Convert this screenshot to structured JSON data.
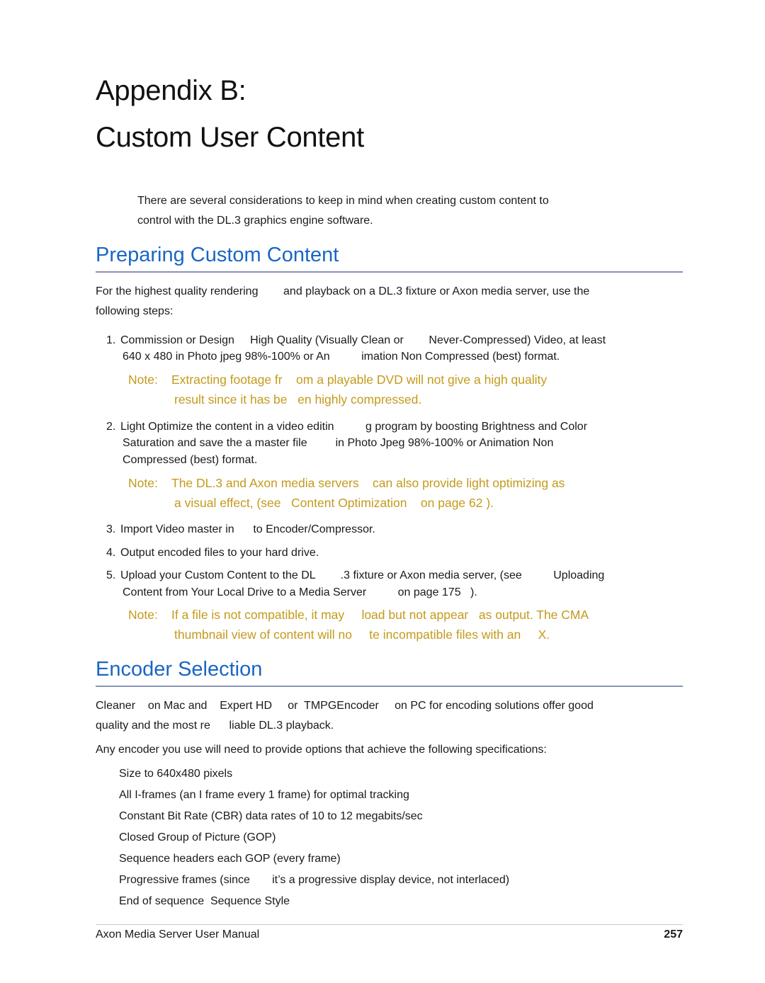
{
  "page": {
    "title_line1": "Appendix B:",
    "title_line2": "Custom User Content",
    "intro": [
      "There are several considerations to keep in mind when creating custom content to",
      "control with the DL.3 graphics engine software."
    ]
  },
  "sections": [
    {
      "heading": "Preparing Custom Content",
      "paragraph": [
        "For the highest quality rendering        and playback on a DL.3 fixture or Axon media server, use the",
        "following steps:"
      ],
      "steps": [
        {
          "number": "1.",
          "lines": [
            "Commission or Design     High Quality (Visually Clean or        Never-Compressed) Video, at least",
            "640 x 480 in Photo jpeg 98%-100% or An          imation Non Compressed (best) format."
          ]
        },
        {
          "number": "2.",
          "lines": [
            "Light Optimize the content in a video editin          g program by boosting Brightness and Color",
            "Saturation and save the a master file         in Photo Jpeg 98%-100% or Animation Non",
            "Compressed (best) format."
          ]
        },
        {
          "number": "3.",
          "lines": [
            "Import Video master in      to Encoder/Compressor."
          ]
        },
        {
          "number": "4.",
          "lines": [
            "Output encoded files to your hard drive."
          ]
        },
        {
          "number": "5.",
          "lines": [
            "Upload your Custom Content to the DL        .3 fixture or Axon media server, (see          Uploading",
            "Content from Your Local Drive to a Media Server          on page 175   )."
          ]
        }
      ],
      "notes": [
        {
          "label": "Note:",
          "lines": [
            "Extracting footage fr    om a playable DVD will not give a high quality",
            "result since it has be   en highly compressed."
          ]
        },
        {
          "label": "Note:",
          "lines": [
            "The DL.3 and Axon media servers    can also provide light optimizing as",
            "a visual effect, (see   Content Optimization    on page 62 )."
          ]
        },
        {
          "label": "Note:",
          "lines": [
            "If a file is not compatible, it may     load but not appear   as output. The CMA",
            "thumbnail view of content will no     te incompatible files with an     X."
          ]
        }
      ]
    },
    {
      "heading": "Encoder Selection",
      "paragraph": [
        "Cleaner    on Mac and    Expert HD     or  TMPGEncoder     on PC for encoding solutions offer good",
        "quality and the most re      liable DL.3 playback."
      ],
      "paragraph2": "Any encoder you use will need to provide options that achieve the following specifications:",
      "specs": [
        "Size to 640x480 pixels",
        "All I-frames (an I frame every 1 frame) for optimal tracking",
        "Constant Bit Rate (CBR) data rates of 10 to 12 megabits/sec",
        "Closed Group of Picture (GOP)",
        "Sequence headers each GOP (every frame)",
        "Progressive frames (since       it’s a progressive display device, not interlaced)",
        "End of sequence  Sequence Style"
      ]
    }
  ],
  "footer": {
    "manual_title": "Axon Media Server User Manual",
    "page_number": "257"
  }
}
